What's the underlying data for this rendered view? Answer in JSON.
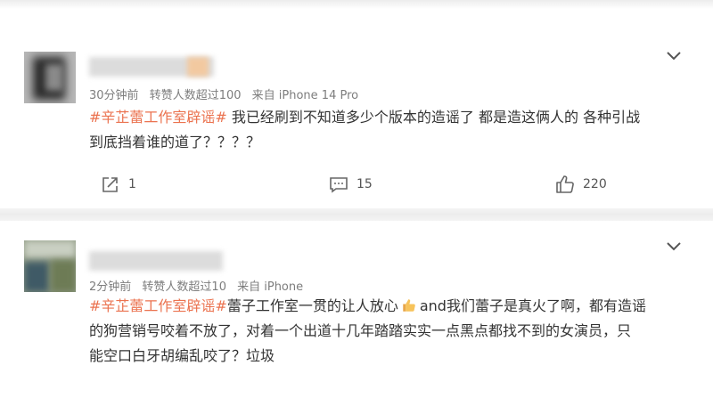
{
  "comments": [
    {
      "time": "30分钟前",
      "reposts": "转赞人数超过100",
      "source": "来自 iPhone 14 Pro",
      "tag": "#辛芷蕾工作室辟谣#",
      "text_line1": " 我已经刷到不知道多少个版本的造谣了 都是造这俩人的 各种引战",
      "text_line2": "到底挡着谁的道了？？？？",
      "actions": {
        "share_count": "1",
        "comment_count": "15",
        "like_count": "220"
      }
    },
    {
      "time": "2分钟前",
      "reposts": "转赞人数超过10",
      "source": "来自 iPhone",
      "tag": "#辛芷蕾工作室辟谣#",
      "text_line1a": "蕾子工作室一贯的让人放心",
      "emoji": "thumbs-up-emoji",
      "text_line1b": "and我们蕾子是真火了啊，都有造谣",
      "text_line2": "的狗营销号咬着不放了，对着一个出道十几年踏踏实实一点黑点都找不到的女演员，只",
      "text_line3": "能空口白牙胡编乱咬了？垃圾"
    }
  ],
  "colors": {
    "tag": "#eb7350",
    "text": "#333333",
    "meta": "#7d7d7d"
  }
}
